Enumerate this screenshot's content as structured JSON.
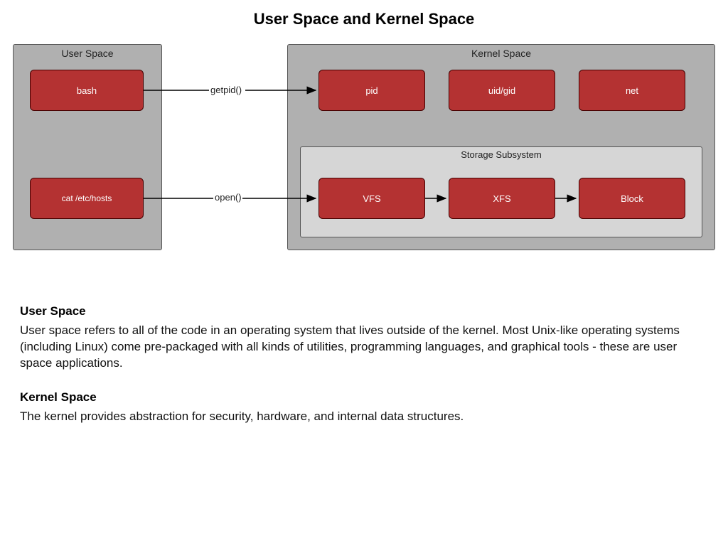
{
  "title": "User Space and Kernel Space",
  "diagram": {
    "user_panel": {
      "title": "User Space"
    },
    "kernel_panel": {
      "title": "Kernel Space"
    },
    "storage_panel": {
      "title": "Storage Subsystem"
    },
    "boxes": {
      "bash": "bash",
      "cat": "cat /etc/hosts",
      "pid": "pid",
      "uidgid": "uid/gid",
      "net": "net",
      "vfs": "VFS",
      "xfs": "XFS",
      "block": "Block"
    },
    "edges": {
      "getpid": "getpid()",
      "open": "open()"
    }
  },
  "sections": [
    {
      "heading": "User Space",
      "body": "User space refers to all of the code in an operating system that lives outside of the kernel. Most Unix-like operating systems (including Linux) come pre-packaged with all kinds of utilities, programming languages, and graphical tools - these are user space applications."
    },
    {
      "heading": "Kernel Space",
      "body": "The kernel provides abstraction for security, hardware, and internal data structures."
    }
  ]
}
